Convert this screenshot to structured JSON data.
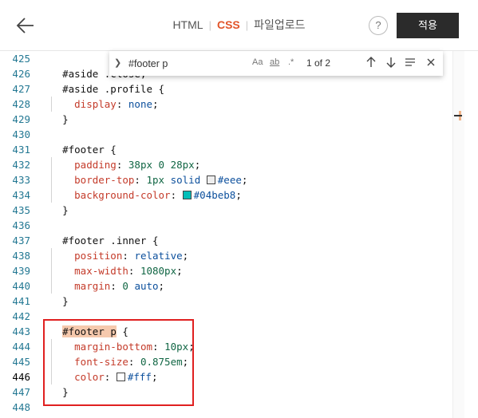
{
  "header": {
    "tabs": [
      {
        "label": "HTML"
      },
      {
        "label": "CSS"
      },
      {
        "label": "파일업로드"
      }
    ],
    "separator": "|",
    "help_label": "?",
    "apply_label": "적용"
  },
  "find": {
    "value": "#footer p",
    "option_case": "Aa",
    "option_word": "ab",
    "option_regex": ".*",
    "count": "1 of 2"
  },
  "colors": {
    "accent": "#e2552a",
    "swatch_teal": "#04beb8",
    "swatch_white": "#ffffff",
    "annotation_red": "#e02020"
  },
  "editor": {
    "current_line": "446",
    "lines": [
      {
        "no": "425",
        "text": ""
      },
      {
        "no": "426",
        "text": "#aside .close,"
      },
      {
        "no": "427",
        "text": "#aside .profile {"
      },
      {
        "no": "428",
        "text": "  display: none;"
      },
      {
        "no": "429",
        "text": "}"
      },
      {
        "no": "430",
        "text": ""
      },
      {
        "no": "431",
        "text": "#footer {"
      },
      {
        "no": "432",
        "text": "  padding: 38px 0 28px;"
      },
      {
        "no": "433",
        "text": "  border-top: 1px solid #eee;"
      },
      {
        "no": "434",
        "text": "  background-color: #04beb8;"
      },
      {
        "no": "435",
        "text": "}"
      },
      {
        "no": "436",
        "text": ""
      },
      {
        "no": "437",
        "text": "#footer .inner {"
      },
      {
        "no": "438",
        "text": "  position: relative;"
      },
      {
        "no": "439",
        "text": "  max-width: 1080px;"
      },
      {
        "no": "440",
        "text": "  margin: 0 auto;"
      },
      {
        "no": "441",
        "text": "}"
      },
      {
        "no": "442",
        "text": ""
      },
      {
        "no": "443",
        "text": "#footer p {"
      },
      {
        "no": "444",
        "text": "  margin-bottom: 10px;"
      },
      {
        "no": "445",
        "text": "  font-size: 0.875em;"
      },
      {
        "no": "446",
        "text": "  color: #fff;"
      },
      {
        "no": "447",
        "text": "}"
      },
      {
        "no": "448",
        "text": ""
      }
    ]
  }
}
